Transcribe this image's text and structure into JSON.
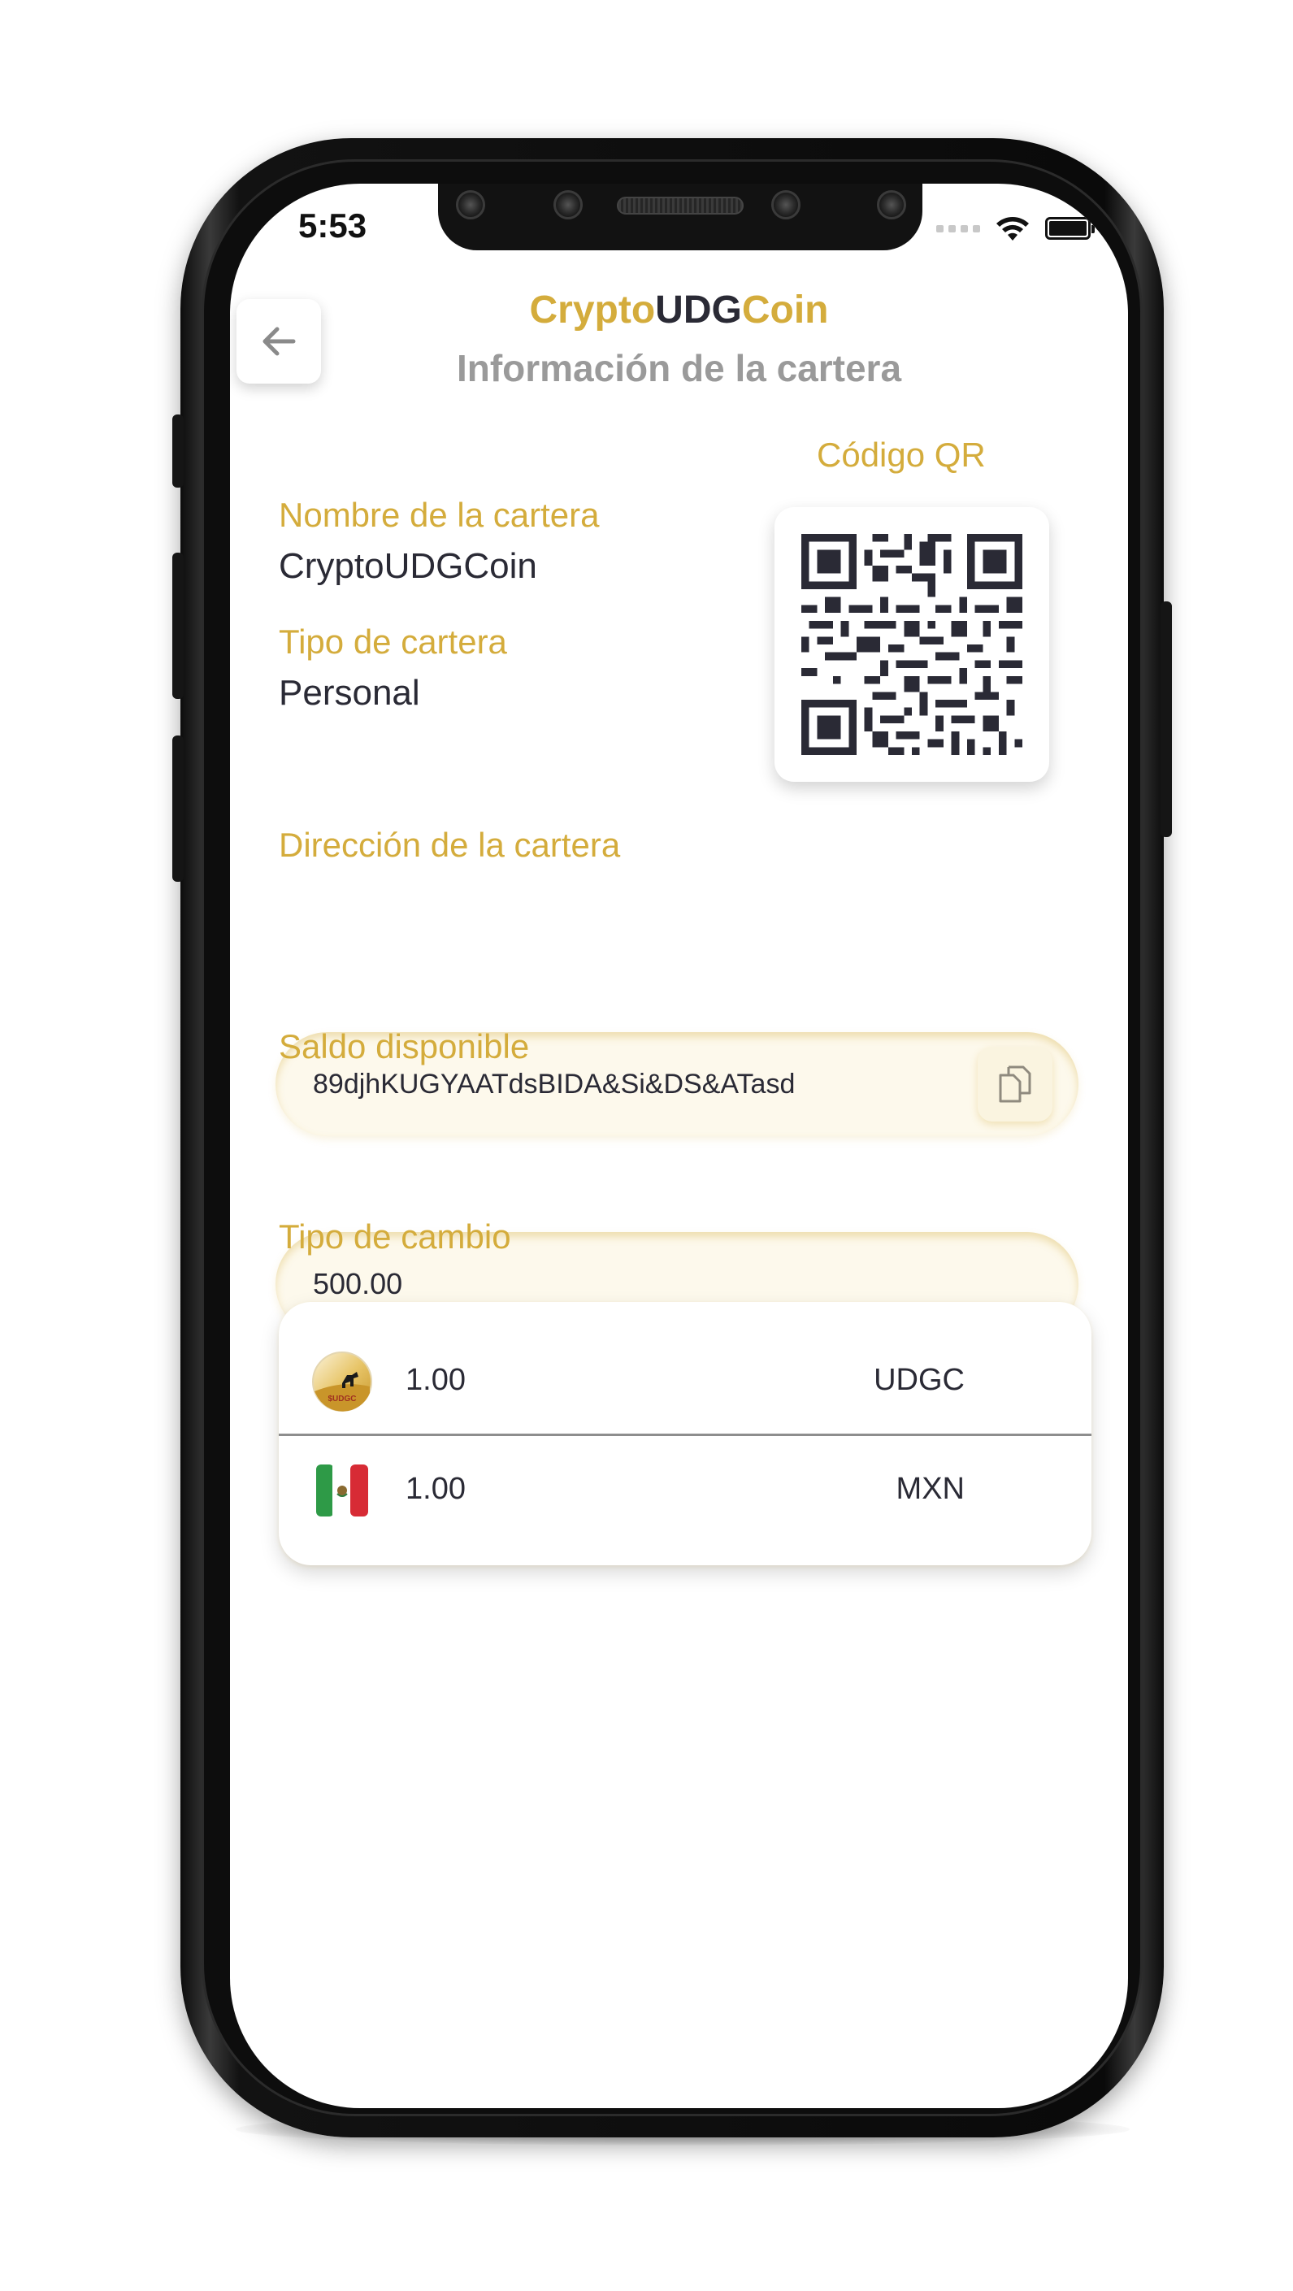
{
  "status_bar": {
    "time": "5:53",
    "signal_icon": "signal-dots-icon",
    "wifi_icon": "wifi-icon",
    "battery_icon": "battery-icon"
  },
  "header": {
    "back_icon": "arrow-left-icon",
    "brand_part_1": "Crypto",
    "brand_part_2": "UDG",
    "brand_part_3": "Coin",
    "subtitle": "Información de la cartera"
  },
  "wallet": {
    "name_label": "Nombre de la cartera",
    "name_value": "CryptoUDGCoin",
    "type_label": "Tipo de cartera",
    "type_value": "Personal",
    "qr_label": "Código QR",
    "address_label": "Dirección de la cartera",
    "address_value": "89djhKUGYAATdsBIDA&Si&DS&ATasd",
    "copy_icon": "copy-icon",
    "balance_label": "Saldo disponible",
    "balance_value": "500.00"
  },
  "exchange": {
    "label": "Tipo de cambio",
    "rows": [
      {
        "amount": "1.00",
        "code": "UDGC",
        "icon": "udgc-coin-icon"
      },
      {
        "amount": "1.00",
        "code": "MXN",
        "icon": "mexico-flag-icon"
      }
    ]
  },
  "colors": {
    "accent_gold": "#d4ac3c",
    "text_dark": "#2a2a35",
    "subtitle_gray": "#9a9a9a"
  }
}
